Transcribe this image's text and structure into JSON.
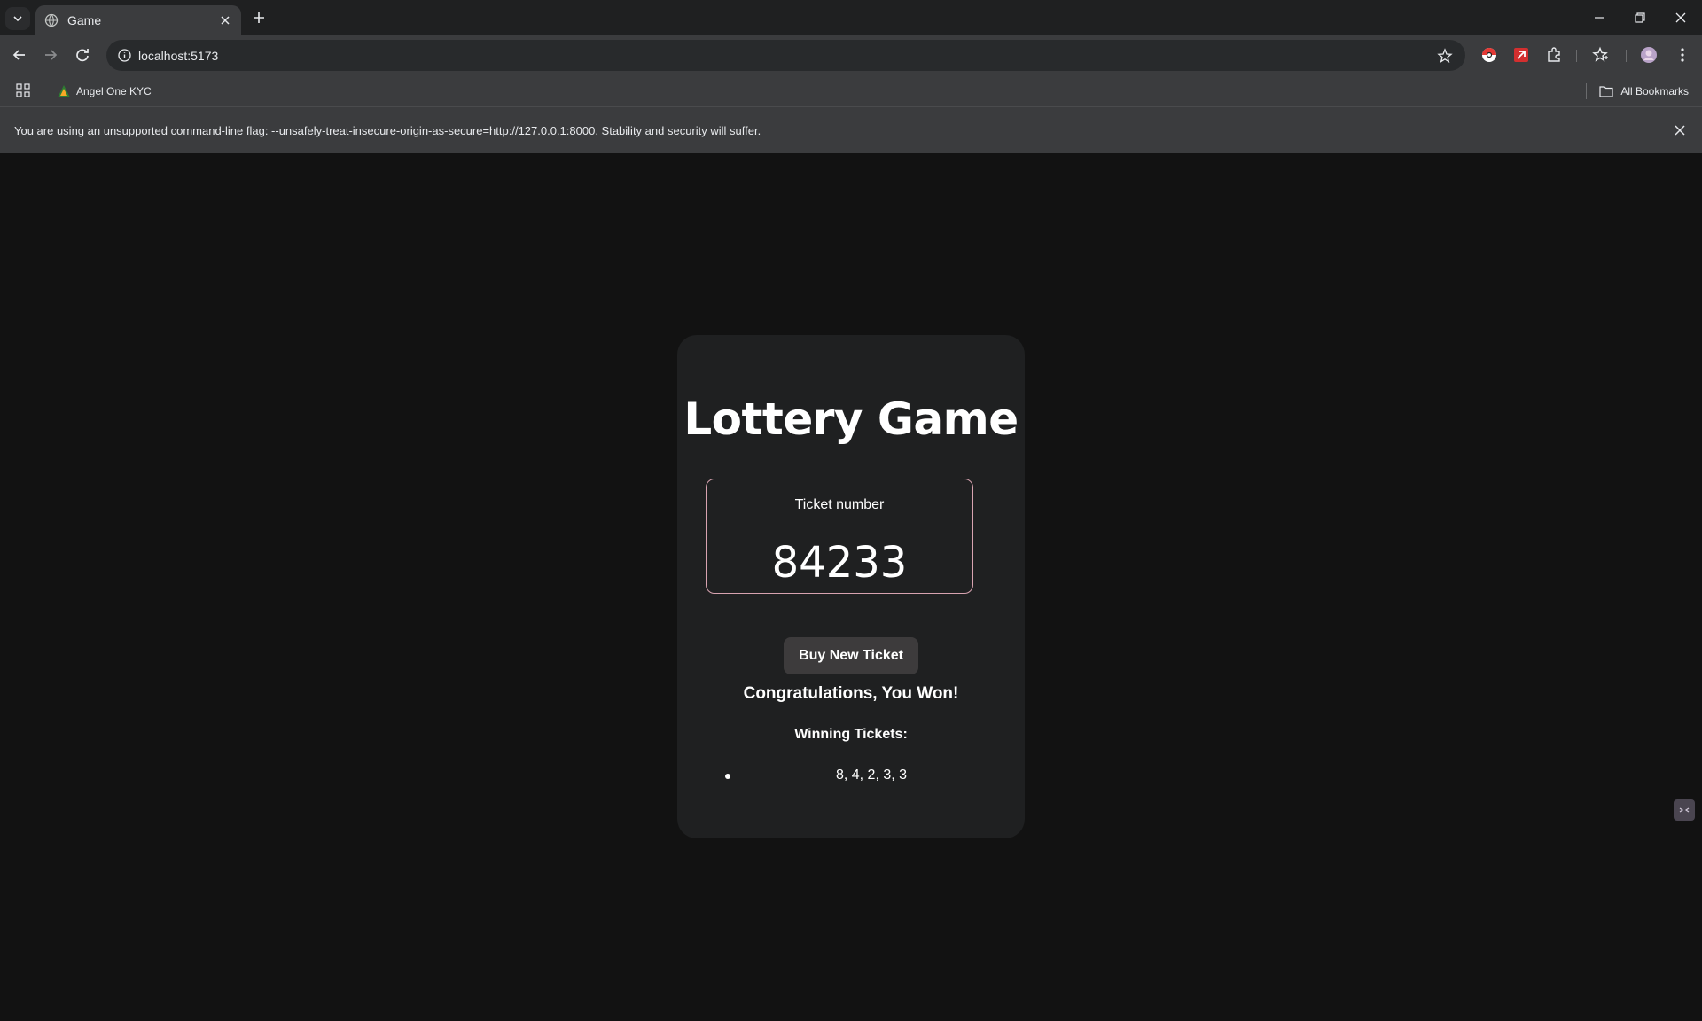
{
  "browser": {
    "tab": {
      "title": "Game"
    },
    "address": {
      "url": "localhost:5173"
    },
    "bookmarks": {
      "item_label": "Angel One KYC",
      "all_label": "All Bookmarks"
    },
    "infobar": {
      "message": "You are using an unsupported command-line flag: --unsafely-treat-insecure-origin-as-secure=http://127.0.0.1:8000. Stability and security will suffer."
    }
  },
  "game": {
    "title": "Lottery Game",
    "ticket_label": "Ticket number",
    "ticket_number": "84233",
    "buy_button": "Buy New Ticket",
    "result_message": "Congratulations, You Won!",
    "winning_title": "Winning Tickets:",
    "winning_tickets": [
      "8, 4, 2, 3, 3"
    ]
  },
  "colors": {
    "page_bg": "#121212",
    "card_bg": "#1f2021",
    "ticket_border": "#d7a3b0",
    "button_bg": "#3d3b3c"
  }
}
